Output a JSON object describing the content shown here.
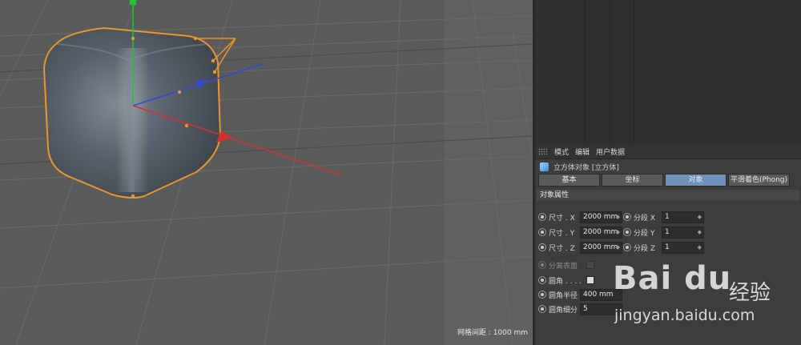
{
  "viewport": {
    "grid_readout": "网格间距 : 1000 mm"
  },
  "attributes": {
    "menu": [
      "模式",
      "编辑",
      "用户数据"
    ],
    "object_title": "立方体对象 [立方体]",
    "tabs": [
      {
        "label": "基本",
        "active": false
      },
      {
        "label": "坐标",
        "active": false
      },
      {
        "label": "对象",
        "active": true
      },
      {
        "label": "平滑着色(Phong)",
        "active": false
      }
    ],
    "section_title": "对象属性",
    "size_x_label": "尺寸 . X",
    "size_x_value": "2000 mm",
    "size_y_label": "尺寸 . Y",
    "size_y_value": "2000 mm",
    "size_z_label": "尺寸 . Z",
    "size_z_value": "2000 mm",
    "seg_x_label": "分段 X",
    "seg_x_value": "1",
    "seg_y_label": "分段 Y",
    "seg_y_value": "1",
    "seg_z_label": "分段 Z",
    "seg_z_value": "1",
    "separate_surfaces_label": "分离表面",
    "fillet_label": "圆角 . . . .",
    "fillet_radius_label": "圆角半径",
    "fillet_radius_value": "400 mm",
    "fillet_subdiv_label": "圆角细分",
    "fillet_subdiv_value": "5"
  },
  "watermark": {
    "brand": "Bai du",
    "brand_cn": "经验",
    "url": "jingyan.baidu.com"
  },
  "colors": {
    "viewport_bg": "#5b5b5b",
    "selection_outline": "#e8962e",
    "axis_x": "#d83030",
    "axis_y": "#22c23a",
    "axis_z": "#3448d8",
    "active_tab": "#6f90b8"
  }
}
